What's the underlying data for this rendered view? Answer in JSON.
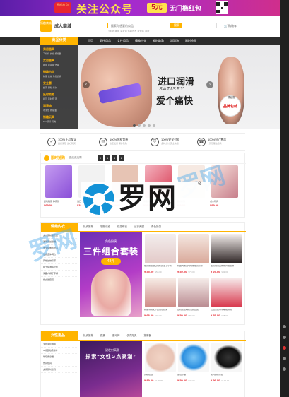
{
  "promo": {
    "gift": "微信红包",
    "slogan": "关注公众号",
    "amount": "5元",
    "tail": "无门槛红包"
  },
  "header": {
    "logo": "情趣商城",
    "brand": "成人商城",
    "search_placeholder": "搜索你想要的商品",
    "search_button": "搜索",
    "hot_words": "飞机杯  跳蛋  润滑油  情趣内衣  按摩棒  延时",
    "cart": "购物车"
  },
  "nav": {
    "category": "商品分类",
    "links": [
      "首页",
      "男性用品",
      "女性用品",
      "情趣内衣",
      "延时助勃",
      "润滑油",
      "限时抢购"
    ]
  },
  "category_menu": [
    {
      "title": "男用器具",
      "sub": "飞机杯 倒模 按摩器"
    },
    {
      "title": "女用器具",
      "sub": "跳蛋 震动棒 仿真"
    },
    {
      "title": "情趣内衣",
      "sub": "制服 丝袜 角色扮演"
    },
    {
      "title": "安全套",
      "sub": "超薄 颗粒 持久"
    },
    {
      "title": "延时助勃",
      "sub": "喷剂 延时套 环"
    },
    {
      "title": "润滑油",
      "sub": "水溶性 按摩油"
    },
    {
      "title": "情趣玩具",
      "sub": "SM 调情 另类"
    }
  ],
  "hero": {
    "line1": "进口润滑",
    "line2": "SATISFY",
    "line3": "爱个痛快",
    "badge_top": "一件起批",
    "badge_main": "品牌包邮",
    "prev": "‹",
    "next": "›"
  },
  "guarantees": [
    {
      "icon": "✓",
      "label": "100%正品保证",
      "sub": "品质保障 放心购买"
    },
    {
      "icon": "✉",
      "label": "100%隐私包装",
      "sub": "私密发货 保护隐私"
    },
    {
      "icon": "⛨",
      "label": "100%安全付款",
      "sub": "多种支付 安全快捷"
    },
    {
      "icon": "☎",
      "label": "100%贴心售后",
      "sub": "7天无理由退换"
    }
  ],
  "flash": {
    "title": "限时抢购",
    "countdown_label": "距结束还剩",
    "digits": [
      "0",
      "6",
      "4",
      "2"
    ],
    "items": [
      {
        "name": "震动跳蛋 静音款",
        "price": "¥69.00",
        "color": "#8a4fd8"
      },
      {
        "name": "进口润滑液",
        "price": "¥38.00",
        "color": "#f2f2f2"
      },
      {
        "name": "仿真按摩棒",
        "price": "¥128.00",
        "color": "#e7c4b4"
      },
      {
        "name": "情趣内衣套装",
        "price": "¥59.00",
        "color": "#d83a52"
      },
      {
        "name": "延时喷剂",
        "price": "¥88.00",
        "color": "#f6e9e2"
      },
      {
        "name": "成人玩具",
        "price": "¥99.00",
        "color": "#f2d5cd"
      }
    ]
  },
  "lingerie": {
    "title": "情趣内衣",
    "tabs": [
      "热卖推荐",
      "制服诱惑",
      "性感睡衣",
      "丝袜美腿",
      "角色扮演"
    ],
    "side": [
      "女仆装制服套装",
      "透明蕾丝睡裙",
      "学生装角色扮演",
      "性感连体网衣",
      "开档丝袜吊带",
      "护士装诱惑套装",
      "情趣内裤丁字裤",
      "兔女郎套装"
    ],
    "promo_top": "角色扮演",
    "promo_main": "三件组合套装",
    "promo_price": "48元",
    "products": [
      {
        "name": "性感蕾丝镂空内裤女士丁字裤",
        "price": "¥ 35.00",
        "old": "¥58.00"
      },
      {
        "name": "情趣内衣透明睡裙性感吊带",
        "price": "¥ 49.00",
        "old": "¥79.00"
      },
      {
        "name": "性感网衣连体袜开档丝袜",
        "price": "¥ 29.00",
        "old": "¥49.00"
      },
      {
        "name": "制服诱惑女仆装角色扮演",
        "price": "¥ 68.00",
        "old": "¥99.00"
      },
      {
        "name": "透视蕾丝睡衣性感套装",
        "price": "¥ 59.00",
        "old": "¥89.00"
      },
      {
        "name": "情趣内衣三点式比基尼",
        "price": "¥ 39.00",
        "old": "¥65.00"
      },
      {
        "name": "性感开档连裤袜黑丝",
        "price": "¥ 25.00",
        "old": "¥39.00"
      },
      {
        "name": "红色蕾丝吊带睡裙诱惑",
        "price": "¥ 55.00",
        "old": "¥88.00"
      }
    ]
  },
  "female": {
    "title": "女性用品",
    "tabs": [
      "热卖推荐",
      "跳蛋",
      "震动棒",
      "仿真阳具",
      "按摩器"
    ],
    "side": [
      "无线遥控跳蛋",
      "G点震动按摩棒",
      "吮吸按摩器",
      "仿真阳具",
      "女用延时喷剂"
    ],
    "promo_top": "一键发射高潮",
    "promo_main": "探索“女性G点高潮”",
    "products": [
      {
        "name": "倒模名器",
        "price": "¥ 89.00",
        "old": "¥129.00"
      },
      {
        "name": "蓝色水晶",
        "price": "¥ 59.00",
        "old": "¥79.00"
      },
      {
        "name": "前列腺按摩器",
        "price": "¥ 99.00",
        "old": "¥139.00"
      }
    ]
  },
  "watermark": {
    "text": "罗网",
    "reg": "®",
    "overlay": [
      "罗网",
      "罗网"
    ]
  }
}
